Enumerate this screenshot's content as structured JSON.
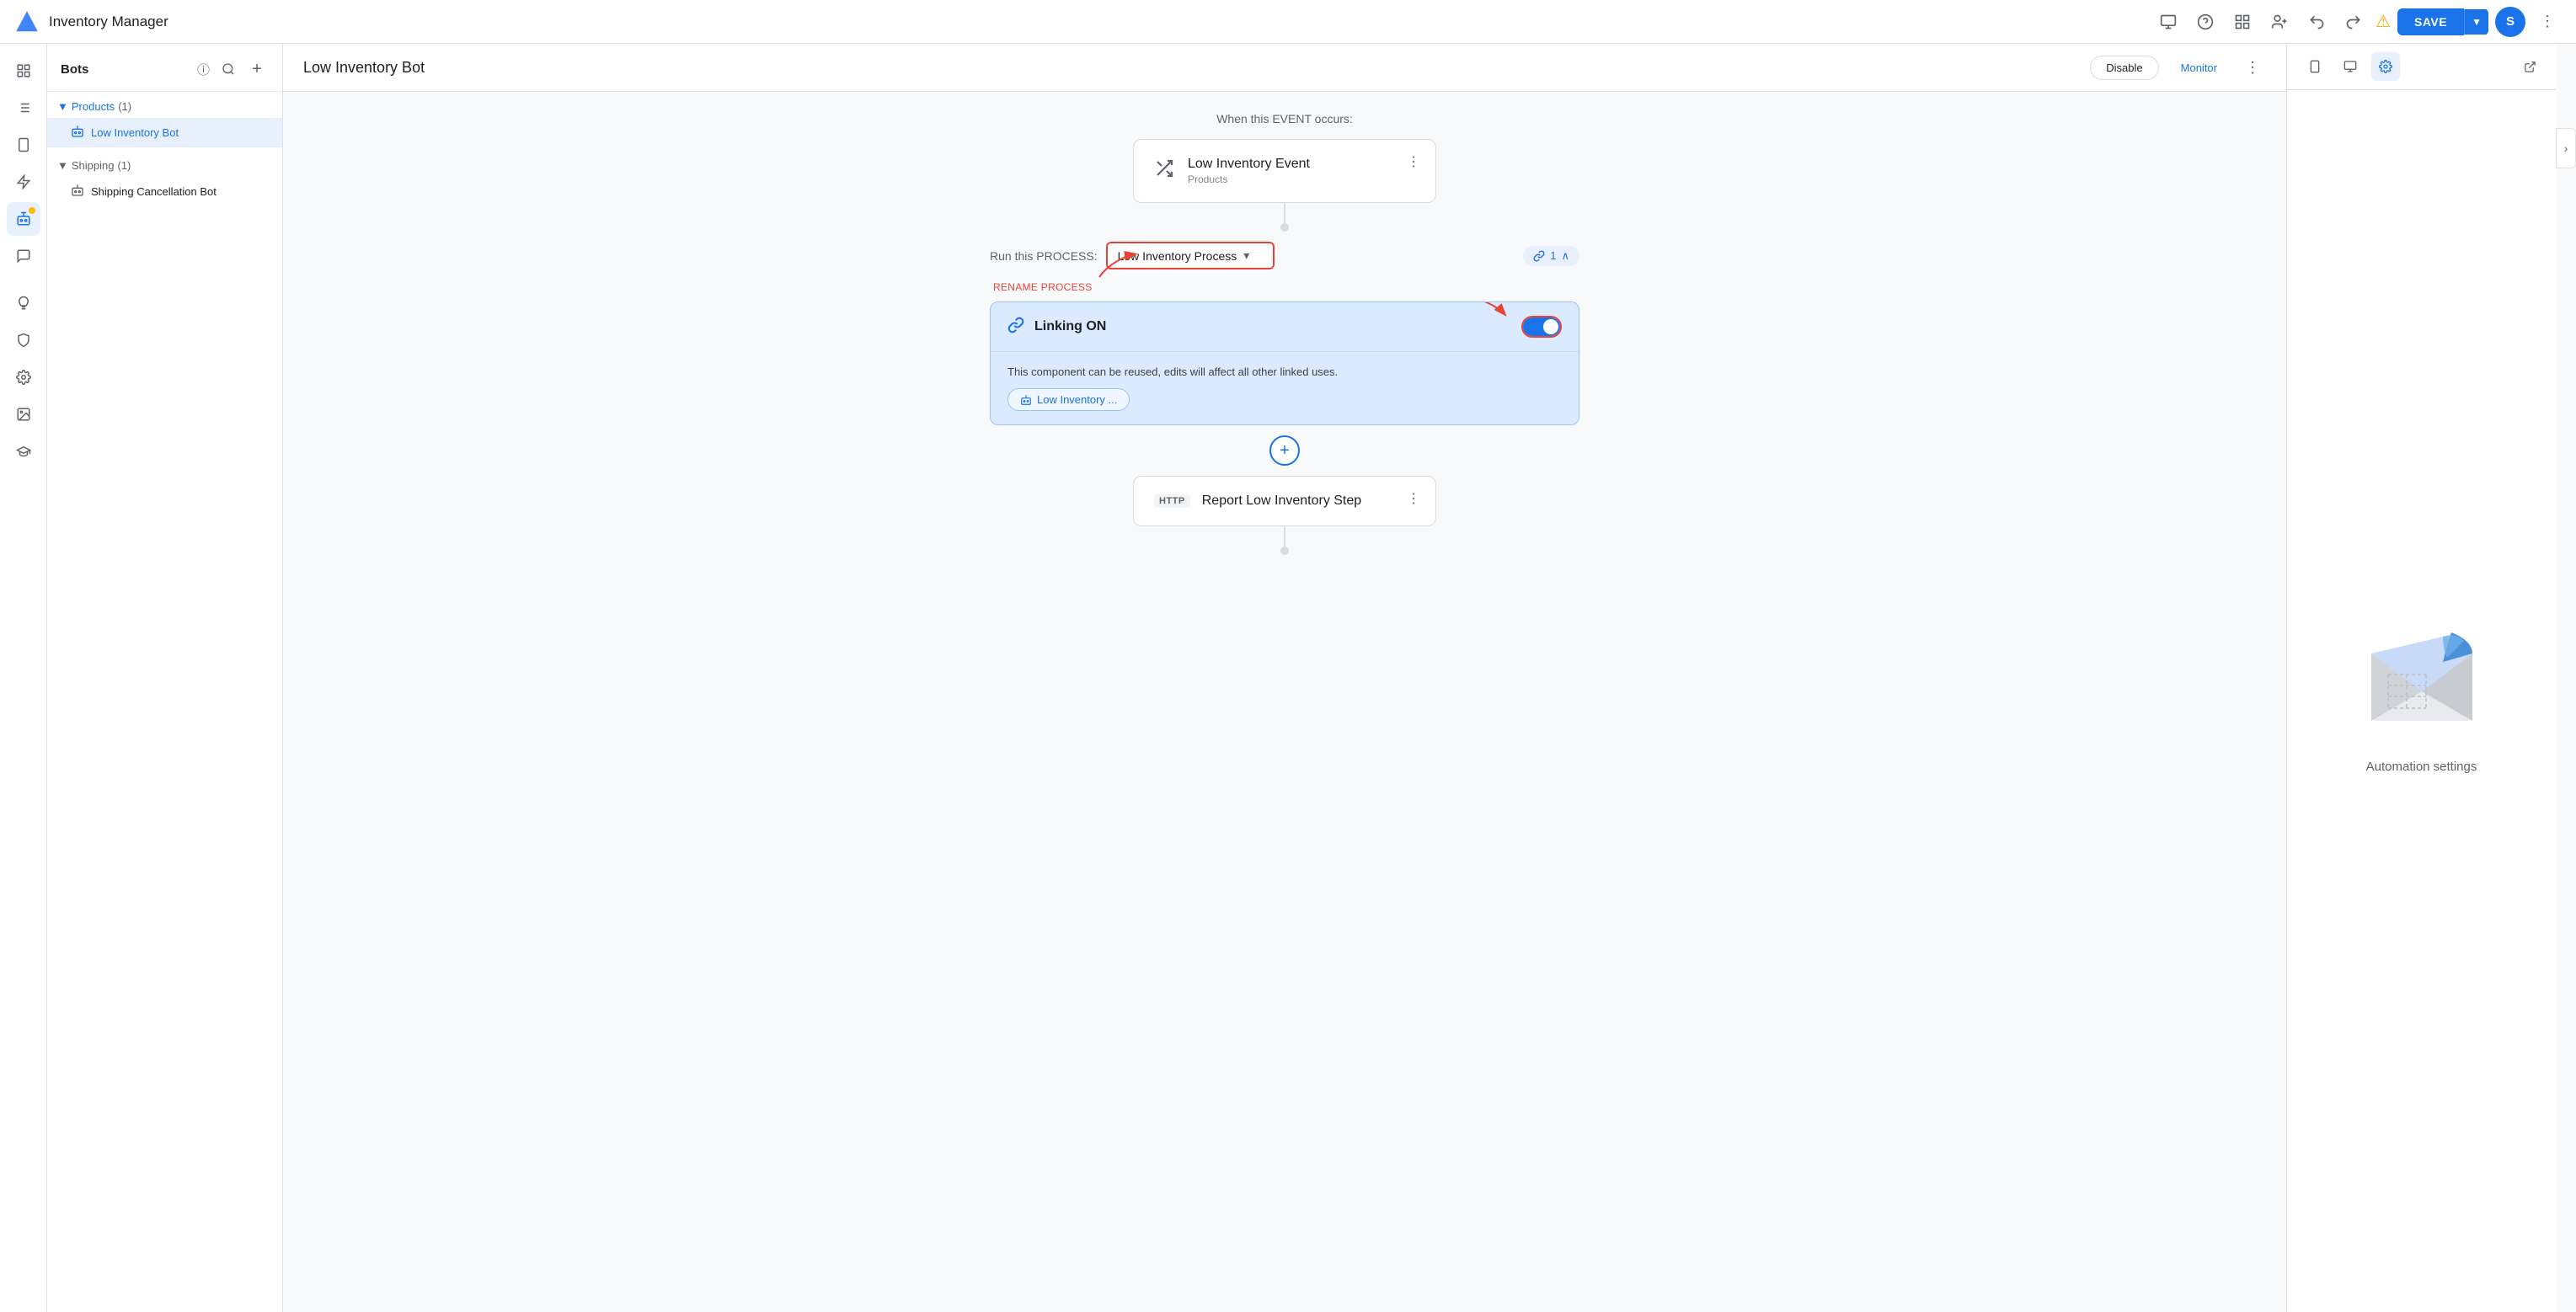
{
  "app": {
    "title": "Inventory Manager",
    "save_label": "SAVE"
  },
  "nav": {
    "icons": [
      "monitor",
      "help",
      "grid",
      "person-add",
      "undo",
      "redo",
      "warning"
    ],
    "avatar_label": "S"
  },
  "left_sidebar": {
    "items": [
      {
        "name": "grid-icon",
        "icon": "⊞"
      },
      {
        "name": "list-icon",
        "icon": "☰"
      },
      {
        "name": "phone-icon",
        "icon": "📱"
      },
      {
        "name": "bolt-icon",
        "icon": "⚡"
      },
      {
        "name": "bot-icon",
        "icon": "🤖",
        "active": true,
        "badge": true
      },
      {
        "name": "chat-icon",
        "icon": "💬"
      },
      {
        "name": "bulb-icon",
        "icon": "💡"
      },
      {
        "name": "shield-icon",
        "icon": "🛡"
      },
      {
        "name": "gear-icon",
        "icon": "⚙"
      },
      {
        "name": "image-icon",
        "icon": "🖼"
      },
      {
        "name": "grad-icon",
        "icon": "🎓"
      }
    ]
  },
  "bots_panel": {
    "title": "Bots",
    "info_icon": "ℹ",
    "search_icon": "🔍",
    "add_icon": "+",
    "sections": [
      {
        "name": "Products",
        "count": 1,
        "expanded": true,
        "items": [
          {
            "label": "Low Inventory Bot",
            "active": true
          }
        ]
      },
      {
        "name": "Shipping",
        "count": 1,
        "expanded": true,
        "items": [
          {
            "label": "Shipping Cancellation Bot",
            "active": false
          }
        ]
      }
    ]
  },
  "content_header": {
    "title": "Low Inventory Bot",
    "disable_label": "Disable",
    "monitor_label": "Monitor"
  },
  "canvas": {
    "event_label": "When this EVENT occurs:",
    "event_card": {
      "icon": "⇄",
      "title": "Low Inventory Event",
      "subtitle": "Products"
    },
    "process_label": "Run this PROCESS:",
    "process_name": "Low Inventory Process",
    "link_badge": "🔗 1",
    "rename_label": "RENAME PROCESS",
    "linking_title": "Linking ON",
    "linking_desc": "This component can be reused, edits will affect all other linked uses.",
    "linked_bot_label": "Low Inventory ...",
    "http_card": {
      "badge": "HTTP",
      "title": "Report Low Inventory Step"
    }
  },
  "right_panel": {
    "settings_label": "Automation settings"
  }
}
